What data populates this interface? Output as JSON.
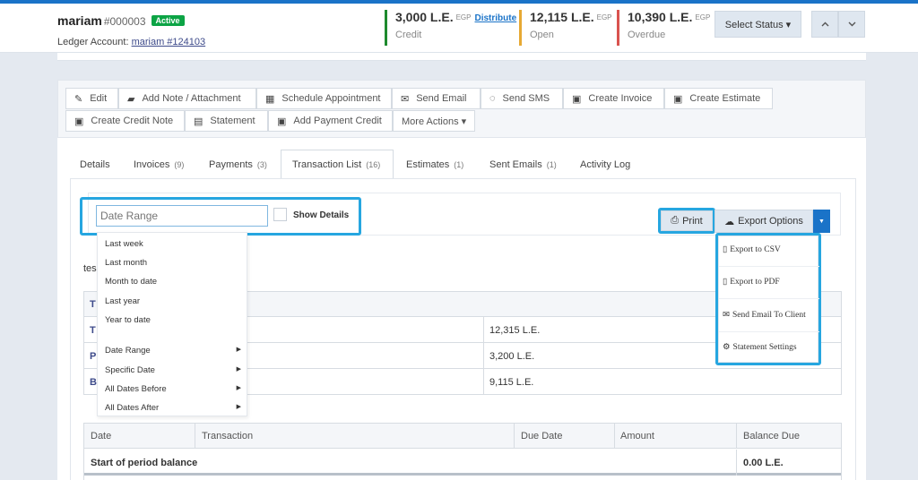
{
  "customer": {
    "name": "mariam",
    "number": "#000003",
    "status": "Active",
    "ledger_label": "Ledger Account:",
    "ledger_link": "mariam #124103"
  },
  "stats": [
    {
      "amount": "3,000 L.E.",
      "currency": "EGP",
      "label": "Credit",
      "action": "Distribute",
      "color": "#1e8a2e"
    },
    {
      "amount": "12,115 L.E.",
      "currency": "EGP",
      "label": "Open",
      "color": "#e7a933"
    },
    {
      "amount": "10,390 L.E.",
      "currency": "EGP",
      "label": "Overdue",
      "color": "#d9534f"
    }
  ],
  "header_buttons": {
    "select_status": "Select Status ▾",
    "up_icon": "chevron-up-icon",
    "down_icon": "chevron-down-icon"
  },
  "toolbar": {
    "row1": [
      {
        "label": "Edit",
        "icon": "pencil-icon"
      },
      {
        "label": "Add Note / Attachment",
        "icon": "book-icon"
      },
      {
        "label": "Schedule Appointment",
        "icon": "calendar-icon"
      },
      {
        "label": "Send Email",
        "icon": "envelope-icon"
      },
      {
        "label": "Send SMS",
        "icon": "chat-icon"
      },
      {
        "label": "Create Invoice",
        "icon": "money-icon"
      },
      {
        "label": "Create Estimate",
        "icon": "money-icon"
      }
    ],
    "row2": [
      {
        "label": "Create Credit Note",
        "icon": "money-icon"
      },
      {
        "label": "Statement",
        "icon": "calculator-icon"
      },
      {
        "label": "Add Payment Credit",
        "icon": "money-icon"
      },
      {
        "label": "More Actions ▾"
      }
    ]
  },
  "tabs": [
    {
      "label": "Details",
      "count": ""
    },
    {
      "label": "Invoices",
      "count": "(9)"
    },
    {
      "label": "Payments",
      "count": "(3)"
    },
    {
      "label": "Transaction List",
      "count": "(16)",
      "active": true
    },
    {
      "label": "Estimates",
      "count": "(1)"
    },
    {
      "label": "Sent Emails",
      "count": "(1)"
    },
    {
      "label": "Activity Log",
      "count": ""
    }
  ],
  "filter": {
    "date_placeholder": "Date Range",
    "show_details": "Show Details",
    "highlight_color": "#26a6e0"
  },
  "date_menu": [
    {
      "label": "Last week"
    },
    {
      "label": "Last month"
    },
    {
      "label": "Month to date"
    },
    {
      "label": "Last year"
    },
    {
      "label": "Year to date"
    },
    {
      "label": "Date Range",
      "submenu": true
    },
    {
      "label": "Specific Date",
      "submenu": true
    },
    {
      "label": "All Dates Before",
      "submenu": true
    },
    {
      "label": "All Dates After",
      "submenu": true
    }
  ],
  "actions": {
    "print": "Print",
    "export": "Export Options"
  },
  "export_menu": [
    {
      "label": "Export to CSV",
      "icon": "csv-file-icon"
    },
    {
      "label": "Export to PDF",
      "icon": "pdf-file-icon"
    },
    {
      "label": "Send Email To Client",
      "icon": "envelope-icon"
    },
    {
      "label": "Statement Settings",
      "icon": "gear-icon"
    }
  ],
  "summary": {
    "tes": "tes",
    "header_letter": "T",
    "rows": [
      {
        "label": "T",
        "value": "12,315 L.E."
      },
      {
        "label": "P",
        "value": "3,200 L.E."
      },
      {
        "label": "B",
        "value": "9,115 L.E."
      }
    ]
  },
  "transactions": {
    "headers": [
      "Date",
      "Transaction",
      "Due Date",
      "Amount",
      "Balance Due"
    ],
    "rows": [
      {
        "label": "Start of period balance",
        "balance": "0.00 L.E."
      }
    ]
  }
}
